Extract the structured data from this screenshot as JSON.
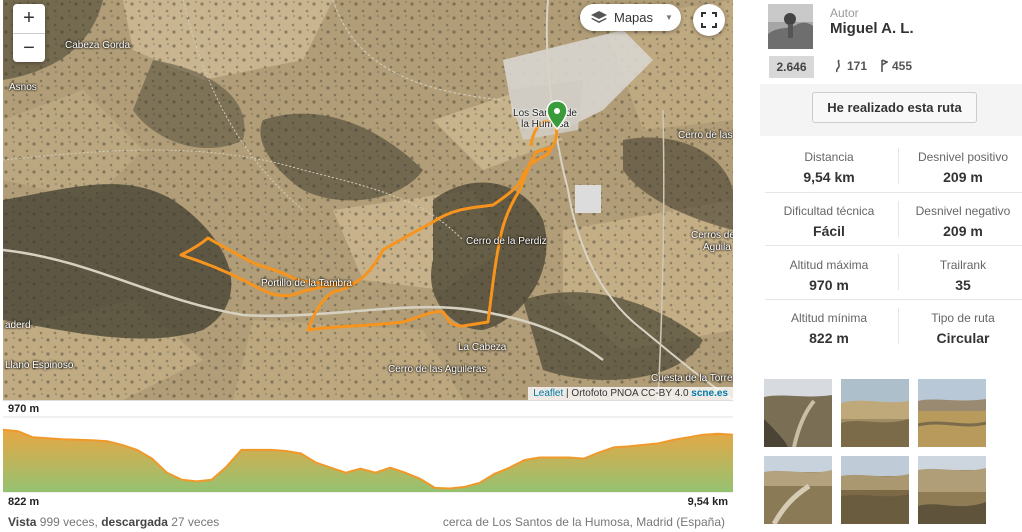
{
  "map": {
    "zoom_in_label": "+",
    "zoom_out_label": "−",
    "layers_label": "Mapas",
    "attribution": {
      "leaflet": "Leaflet",
      "separator": " | ",
      "ortho": "Ortofoto PNOA CC-BY 4.0 ",
      "scne": "scne.es"
    },
    "place_labels": [
      "Cabeza Gorda",
      "Asnos",
      "Cerro de las",
      "Portillo de la Tambra",
      "Cerro de la Perdiz",
      "Cerros de",
      "Aguila",
      "aderd",
      "Llano Espinoso",
      "La Cabeza",
      "Cerro de las Aguileras",
      "Cuesta de la Torre"
    ],
    "town_name": "Los Santos de la Humosa",
    "icons": [
      "plus-icon",
      "minus-icon",
      "layers-icon",
      "caret-down-icon",
      "fullscreen-icon",
      "map-pin-icon"
    ]
  },
  "profile": {
    "max_label": "970 m",
    "min_label": "822 m",
    "distance_label": "9,54 km",
    "elevations_m": [
      945,
      942,
      930,
      928,
      926,
      925,
      924,
      922,
      915,
      905,
      888,
      860,
      846,
      843,
      846,
      872,
      905,
      905,
      905,
      903,
      898,
      880,
      870,
      860,
      868,
      860,
      870,
      860,
      848,
      830,
      829,
      832,
      840,
      858,
      870,
      885,
      890,
      890,
      890,
      888,
      900,
      910,
      912,
      915,
      918,
      925,
      930,
      935,
      937,
      935
    ],
    "colors": {
      "line": "#f0992b",
      "fill_top": "#e6a23a",
      "fill_bottom": "#8fbf6a"
    }
  },
  "footer": {
    "views_label": "Vista",
    "views_count": " 999 veces, ",
    "downloads_label": "descargada",
    "downloads_count": " 27 veces",
    "location": "cerca de Los Santos de la Humosa, Madrid (España)"
  },
  "author": {
    "label": "Autor",
    "name": "Miguel A. L.",
    "badge": "2.646",
    "followers": "171",
    "routes": "455"
  },
  "done_button": "He realizado esta ruta",
  "stats": [
    {
      "label": "Distancia",
      "value": "9,54 km"
    },
    {
      "label": "Desnivel positivo",
      "value": "209 m"
    },
    {
      "label": "Dificultad técnica",
      "value": "Fácil"
    },
    {
      "label": "Desnivel negativo",
      "value": "209 m"
    },
    {
      "label": "Altitud máxima",
      "value": "970 m"
    },
    {
      "label": "Trailrank",
      "value": "35"
    },
    {
      "label": "Altitud mínima",
      "value": "822 m"
    },
    {
      "label": "Tipo de ruta",
      "value": "Circular"
    }
  ],
  "photos": [
    "photo-1",
    "photo-2",
    "photo-3",
    "photo-4",
    "photo-5",
    "photo-6"
  ],
  "colors": {
    "route": "#f7941d",
    "pin": "#3a9b3a"
  }
}
